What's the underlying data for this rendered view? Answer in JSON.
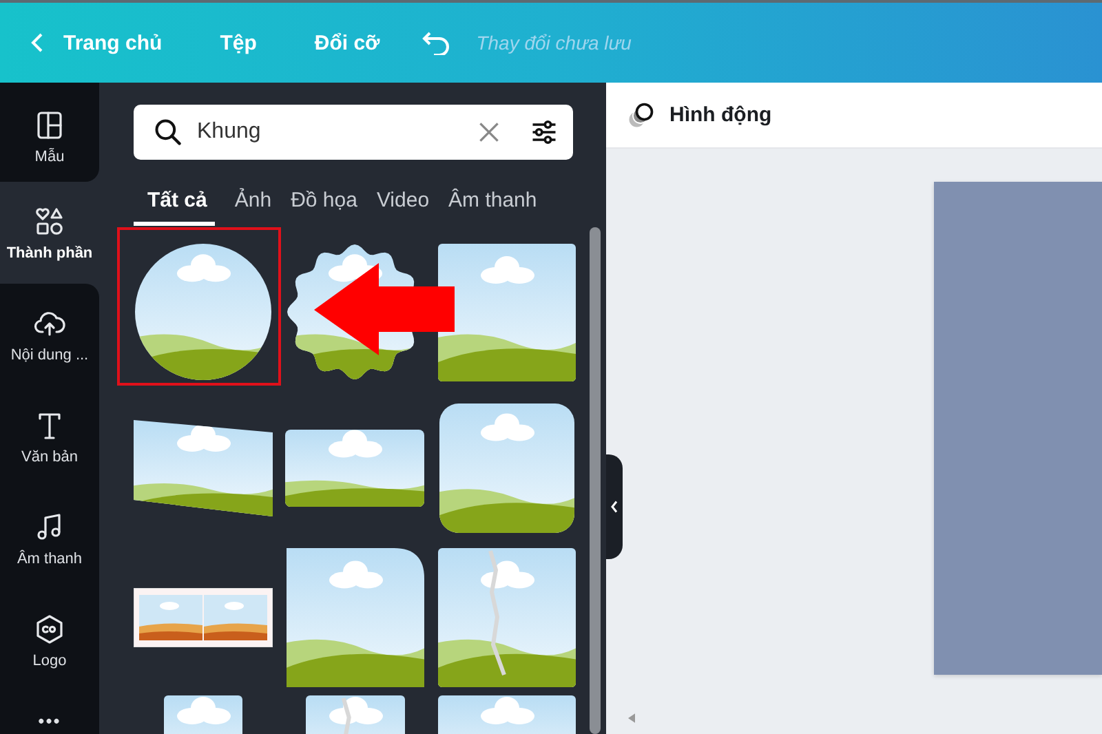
{
  "top_bar": {
    "items": [
      {
        "kind": "back",
        "label": "Trang chủ"
      },
      {
        "kind": "menu",
        "label": "Tệp"
      },
      {
        "kind": "menu",
        "label": "Đổi cỡ"
      },
      {
        "kind": "undo"
      }
    ],
    "status": "Thay đổi chưa lưu"
  },
  "sidebar": {
    "items": [
      {
        "kind": "template",
        "label": "Mẫu",
        "selected": false
      },
      {
        "kind": "elements",
        "label": "Thành phần",
        "selected": true
      },
      {
        "kind": "upload",
        "label": "Nội dung ...",
        "selected": false
      },
      {
        "kind": "text",
        "label": "Văn bản",
        "selected": false
      },
      {
        "kind": "music",
        "label": "Âm thanh",
        "selected": false
      },
      {
        "kind": "logo",
        "label": "Logo",
        "selected": false
      },
      {
        "kind": "more",
        "label": "•••",
        "selected": false
      }
    ]
  },
  "search": {
    "value": "Khung"
  },
  "tabs": [
    {
      "label": "Tất cả",
      "selected": true
    },
    {
      "label": "Ảnh",
      "selected": false
    },
    {
      "label": "Đồ họa",
      "selected": false
    },
    {
      "label": "Video",
      "selected": false
    },
    {
      "label": "Âm thanh",
      "selected": false
    }
  ],
  "frames": [
    {
      "kind": "circle",
      "highlighted": true
    },
    {
      "kind": "scallop",
      "highlighted": false
    },
    {
      "kind": "rounded",
      "highlighted": false
    },
    {
      "kind": "skewed",
      "highlighted": false
    },
    {
      "kind": "wide",
      "highlighted": false
    },
    {
      "kind": "blob",
      "highlighted": false
    },
    {
      "kind": "filmstrip",
      "highlighted": false
    },
    {
      "kind": "corner",
      "highlighted": false
    },
    {
      "kind": "torn",
      "highlighted": false
    },
    {
      "kind": "small",
      "highlighted": false
    },
    {
      "kind": "torn-wide",
      "highlighted": false
    },
    {
      "kind": "plain",
      "highlighted": false
    }
  ],
  "canvas": {
    "header": "Hình động"
  }
}
